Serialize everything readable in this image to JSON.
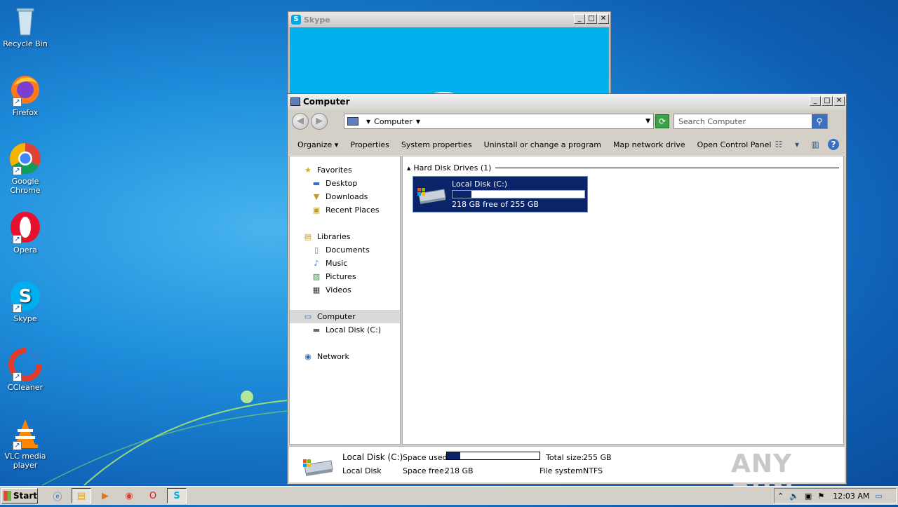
{
  "desktop": {
    "icons": [
      {
        "label": "Recycle Bin",
        "icon": "recycle-bin-icon"
      },
      {
        "label": "Firefox",
        "icon": "firefox-icon"
      },
      {
        "label": "Google Chrome",
        "icon": "chrome-icon"
      },
      {
        "label": "Opera",
        "icon": "opera-icon"
      },
      {
        "label": "Skype",
        "icon": "skype-icon"
      },
      {
        "label": "CCleaner",
        "icon": "ccleaner-icon"
      },
      {
        "label": "VLC media player",
        "icon": "vlc-icon"
      }
    ]
  },
  "skype_window": {
    "title": "Skype"
  },
  "explorer": {
    "title": "Computer",
    "address": "Computer",
    "search_placeholder": "Search Computer",
    "toolbar": [
      "Organize",
      "Properties",
      "System properties",
      "Uninstall or change a program",
      "Map network drive",
      "Open Control Panel"
    ],
    "nav": {
      "favorites": "Favorites",
      "desktop": "Desktop",
      "downloads": "Downloads",
      "recent": "Recent Places",
      "libraries": "Libraries",
      "documents": "Documents",
      "music": "Music",
      "pictures": "Pictures",
      "videos": "Videos",
      "computer": "Computer",
      "local_disk": "Local Disk (C:)",
      "network": "Network"
    },
    "group_header": "Hard Disk Drives (1)",
    "drive": {
      "name": "Local Disk (C:)",
      "free_text": "218 GB free of 255 GB",
      "used_fraction": 0.145
    },
    "details": {
      "name": "Local Disk  (C:)",
      "type": "Local Disk",
      "space_used_label": "Space used:",
      "space_free_label": "Space free:",
      "space_free_value": "218 GB",
      "total_size_label": "Total size:",
      "total_size_value": "255 GB",
      "file_system_label": "File system:",
      "file_system_value": "NTFS",
      "used_fraction": 0.145
    },
    "watermark": "ANY RUN"
  },
  "taskbar": {
    "start_label": "Start",
    "apps": [
      "ie-icon",
      "explorer-icon",
      "media-player-icon",
      "chrome-icon",
      "opera-icon",
      "skype-icon"
    ],
    "clock": "12:03 AM"
  },
  "colors": {
    "selection": "#0a246a",
    "skype_blue": "#00b1ee",
    "chrome_gray": "#d4d0c8"
  }
}
